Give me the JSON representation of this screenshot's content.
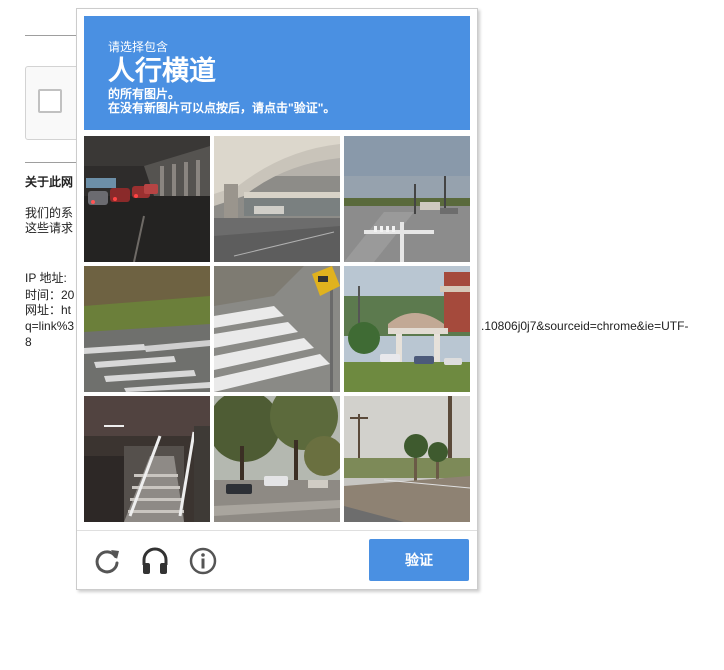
{
  "background_page": {
    "section_heading": "关于此网",
    "line1": "我们的系",
    "line2": "这些请求",
    "ip_label": "IP 地址:",
    "time_label": "时间：20",
    "url_label": "网址：ht",
    "url_q": "q=link%3",
    "url_end": "8",
    "url_tail": ".10806j0j7&sourceid=chrome&ie=UTF-"
  },
  "challenge": {
    "instruction_prefix": "请选择包含",
    "target_object": "人行横道",
    "instruction_suffix": "的所有图片。",
    "instruction_note": "在没有新图片可以点按后，请点击\"验证\"。",
    "tiles": [
      {
        "scene": "tunnel-traffic-night"
      },
      {
        "scene": "overpass-highway"
      },
      {
        "scene": "intersection-crosswalk"
      },
      {
        "scene": "road-crosswalk-grass"
      },
      {
        "scene": "crosswalk-sign"
      },
      {
        "scene": "gas-station"
      },
      {
        "scene": "stairs-railing"
      },
      {
        "scene": "trees-parking"
      },
      {
        "scene": "palm-trees-road"
      }
    ],
    "verify_label": "验证",
    "icons": {
      "reload": "reload-icon",
      "audio": "headphones-icon",
      "info": "info-icon"
    },
    "colors": {
      "accent": "#4a90e2",
      "icon_gray": "#555555"
    }
  }
}
